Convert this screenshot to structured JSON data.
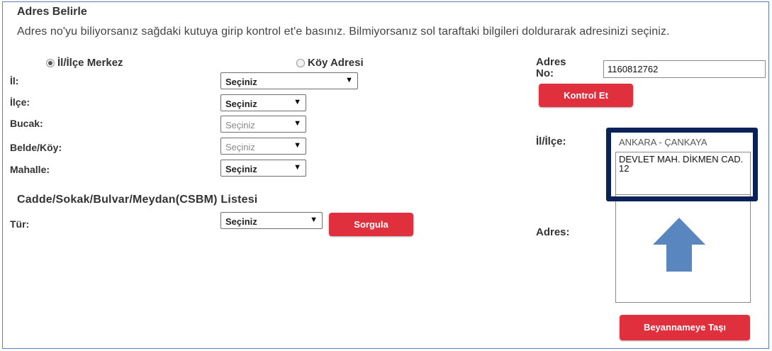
{
  "title": "Adres Belirle",
  "intro": "Adres no'yu biliyorsanız sağdaki kutuya girip kontrol et'e basınız. Bilmiyorsanız sol taraftaki bilgileri doldurarak adresinizi seçiniz.",
  "radios": {
    "merkez": {
      "label": "İl/İlçe Merkez",
      "checked": true
    },
    "koy": {
      "label": "Köy Adresi",
      "checked": false
    }
  },
  "fields": {
    "il": {
      "label": "İl:",
      "value": "Seçiniz"
    },
    "ilce": {
      "label": "İlçe:",
      "value": "Seçiniz"
    },
    "bucak": {
      "label": "Bucak:",
      "value": "Seçiniz"
    },
    "belde": {
      "label": "Belde/Köy:",
      "value": "Seçiniz"
    },
    "mahalle": {
      "label": "Mahalle:",
      "value": "Seçiniz"
    }
  },
  "csbm": {
    "heading": "Cadde/Sokak/Bulvar/Meydan(CSBM) Listesi",
    "tur_label": "Tür:",
    "tur_value": "Seçiniz",
    "sorgula": "Sorgula"
  },
  "adres_no": {
    "label": "Adres No:",
    "value": "1160812762",
    "kontrol": "Kontrol Et"
  },
  "result": {
    "il_ilce_label": "İl/İlçe:",
    "il_ilce_value": "ANKARA - ÇANKAYA",
    "adres_label": "Adres:",
    "adres_value": "DEVLET MAH. DİKMEN CAD. 12"
  },
  "beyanname_button": "Beyannameye Taşı",
  "colors": {
    "red_button": "#e0303e",
    "highlight_border": "#0b2258",
    "arrow": "#5a86c0",
    "frame_border": "#5b7fb4"
  }
}
